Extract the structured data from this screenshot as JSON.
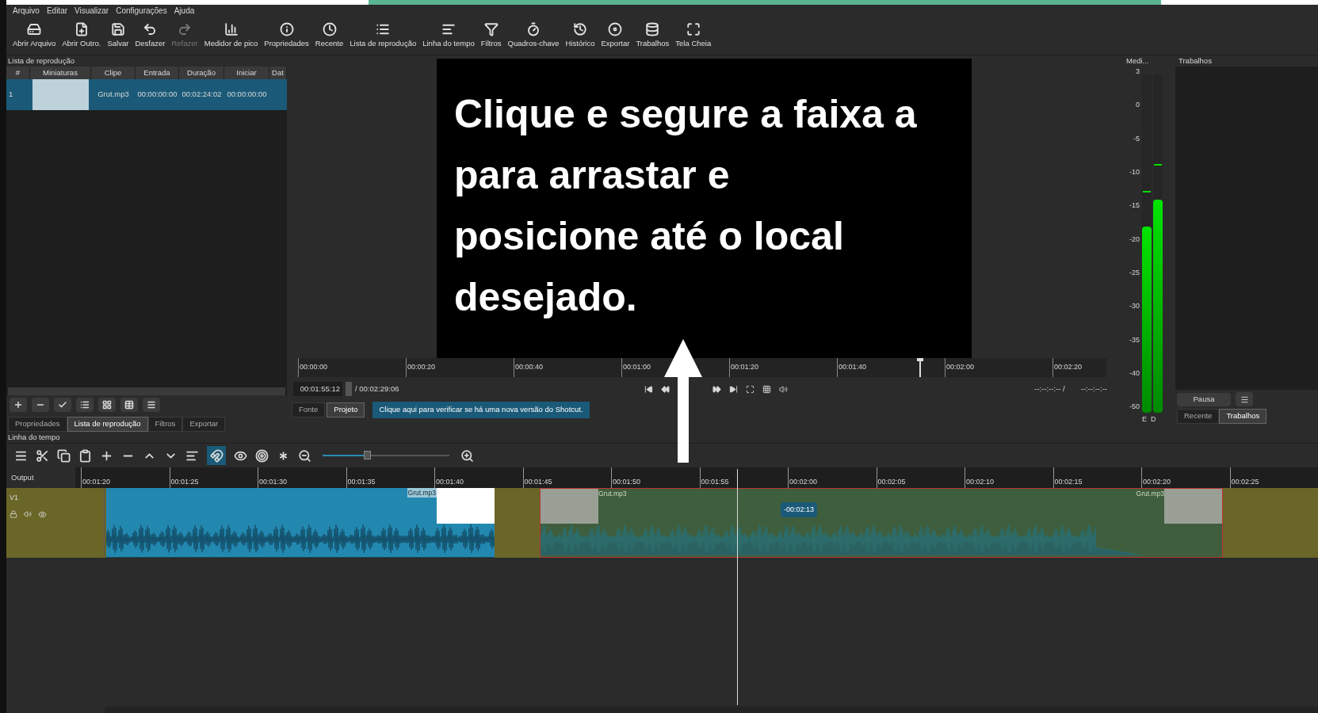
{
  "menu": [
    "Arquivo",
    "Editar",
    "Visualizar",
    "Configurações",
    "Ajuda"
  ],
  "toolbar": [
    {
      "label": "Abrir Arquivo",
      "disabled": false
    },
    {
      "label": "Abrir Outro.",
      "disabled": false
    },
    {
      "label": "Salvar",
      "disabled": false
    },
    {
      "label": "Desfazer",
      "disabled": false
    },
    {
      "label": "Refazer",
      "disabled": true
    },
    {
      "label": "Medidor de pico",
      "disabled": false
    },
    {
      "label": "Propriedades",
      "disabled": false
    },
    {
      "label": "Recente",
      "disabled": false
    },
    {
      "label": "Lista de reprodução",
      "disabled": false
    },
    {
      "label": "Linha do tempo",
      "disabled": false
    },
    {
      "label": "Filtros",
      "disabled": false
    },
    {
      "label": "Quadros-chave",
      "disabled": false
    },
    {
      "label": "Histórico",
      "disabled": false
    },
    {
      "label": "Exportar",
      "disabled": false
    },
    {
      "label": "Trabalhos",
      "disabled": false
    },
    {
      "label": "Tela Cheia",
      "disabled": false
    }
  ],
  "playlist": {
    "title": "Lista de reprodução",
    "columns": [
      "#",
      "Miniaturas",
      "Clipe",
      "Entrada",
      "Duração",
      "Iniciar",
      "Dat"
    ],
    "rows": [
      {
        "number": "1",
        "clip": "Grut.mp3",
        "in": "00:00:00:00",
        "duration": "00:02:24:02",
        "start": "00:00:00:00",
        "selected": true
      }
    ]
  },
  "left_tabs": [
    {
      "label": "Propriedades",
      "selected": false
    },
    {
      "label": "Lista de reprodução",
      "selected": true
    },
    {
      "label": "Filtros",
      "selected": false
    },
    {
      "label": "Exportar",
      "selected": false
    }
  ],
  "player": {
    "overlay_lines": [
      "Clique e segure a faixa a",
      "para arrastar e",
      "posicione até o local",
      "desejado."
    ],
    "ruler": [
      "00:00:00",
      "00:00:20",
      "00:00:40",
      "00:01:00",
      "00:01:20",
      "00:01:40",
      "00:02:00",
      "00:02:20"
    ],
    "playhead": {
      "level": 0.77
    },
    "position": "00:01:55:12",
    "duration": "/ 00:02:29:06",
    "in_point": "--:--:--:-- /",
    "out_point": "--:--:--:--",
    "tabs": [
      {
        "label": "Fonte",
        "selected": false
      },
      {
        "label": "Projeto",
        "selected": true
      }
    ],
    "notice": "Clique aqui para verificar se há uma nova versão do Shotcut."
  },
  "meter": {
    "title": "Medi...",
    "scale": [
      "3",
      "0",
      "-5",
      "-10",
      "-15",
      "-20",
      "-25",
      "-30",
      "-35",
      "-40",
      "-50"
    ],
    "channels": [
      {
        "label": "E",
        "level": 0.55
      },
      {
        "label": "D",
        "level": 0.63
      }
    ]
  },
  "jobs": {
    "title": "Trabalhos",
    "pause": "Pausa",
    "tabs": [
      {
        "label": "Recente",
        "selected": false
      },
      {
        "label": "Trabalhos",
        "selected": true
      }
    ]
  },
  "timeline": {
    "title": "Linha do tempo",
    "snap_on": true,
    "zoom": {
      "level": 0.35
    },
    "output_label": "Output",
    "track": "V1",
    "ruler": [
      "00:01:20",
      "00:01:25",
      "00:01:30",
      "00:01:35",
      "00:01:40",
      "00:01:45",
      "00:01:50",
      "00:01:55",
      "00:02:00",
      "00:02:05",
      "00:02:10",
      "00:02:15",
      "00:02:20",
      "00:02:25"
    ],
    "clips": [
      {
        "kind": "placed",
        "label": "Grut.mp3"
      },
      {
        "kind": "dragging",
        "label": "Grut.mp3",
        "end_label": "Grut.mp3"
      }
    ],
    "tooltip": "-00:02:13"
  }
}
